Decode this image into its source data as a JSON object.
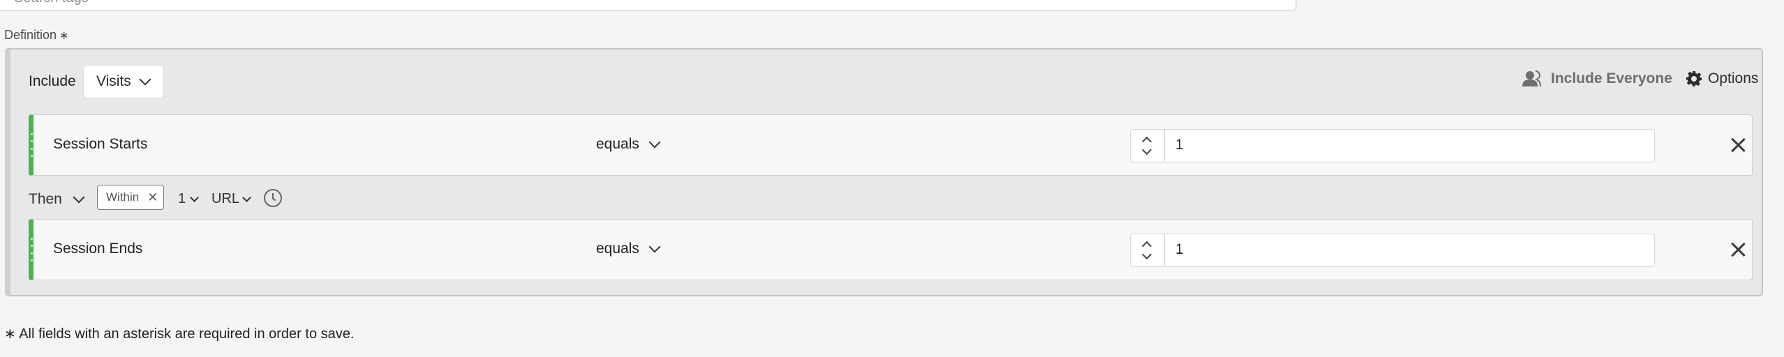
{
  "search": {
    "placeholder": "Search tags"
  },
  "definition": {
    "label": "Definition",
    "required_mark": "∗"
  },
  "header": {
    "include_label": "Include",
    "context_value": "Visits",
    "include_everyone_label": "Include Everyone",
    "options_label": "Options"
  },
  "rules": [
    {
      "name": "Session Starts",
      "operator": "equals",
      "value": "1"
    },
    {
      "name": "Session Ends",
      "operator": "equals",
      "value": "1"
    }
  ],
  "sequence": {
    "then_label": "Then",
    "within_label": "Within",
    "count": "1",
    "unit": "URL"
  },
  "footer": {
    "note": "∗ All fields with an asterisk are required in order to save."
  },
  "colors": {
    "accent_green": "#4bb24f",
    "container_bg": "#e8e8e8"
  },
  "icons": [
    "person-icon",
    "gear-icon",
    "chevron-down-icon",
    "stepper-icon",
    "close-icon",
    "clock-icon",
    "drag-handle-icon"
  ]
}
